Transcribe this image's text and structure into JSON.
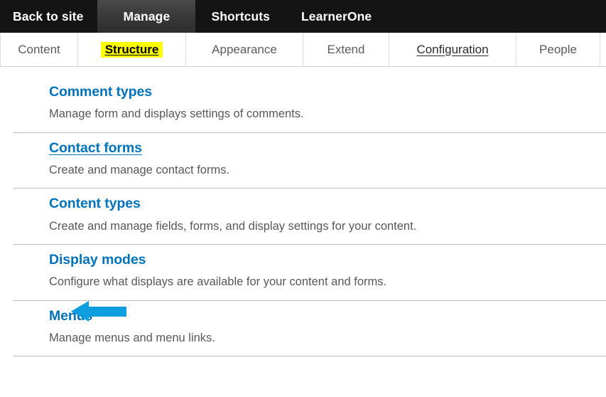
{
  "toolbar": {
    "tabs": [
      {
        "label": "Back to site",
        "active": false,
        "name": "back-to-site"
      },
      {
        "label": "Manage",
        "active": true,
        "name": "manage"
      },
      {
        "label": "Shortcuts",
        "active": false,
        "name": "shortcuts"
      },
      {
        "label": "LearnerOne",
        "active": false,
        "name": "learnerone"
      }
    ]
  },
  "subnav": {
    "tabs": [
      {
        "label": "Content",
        "state": "default"
      },
      {
        "label": "Structure",
        "state": "highlighted"
      },
      {
        "label": "Appearance",
        "state": "default"
      },
      {
        "label": "Extend",
        "state": "default"
      },
      {
        "label": "Configuration",
        "state": "hovered"
      },
      {
        "label": "People",
        "state": "default"
      }
    ]
  },
  "main": {
    "items": [
      {
        "title": "Comment types",
        "description": "Manage form and displays settings of comments.",
        "underlined": false,
        "annotated": false
      },
      {
        "title": "Contact forms",
        "description": "Create and manage contact forms.",
        "underlined": true,
        "annotated": false
      },
      {
        "title": "Content types",
        "description": "Create and manage fields, forms, and display settings for your content.",
        "underlined": false,
        "annotated": false
      },
      {
        "title": "Display modes",
        "description": "Configure what displays are available for your content and forms.",
        "underlined": false,
        "annotated": false
      },
      {
        "title": "Menus",
        "description": "Manage menus and menu links.",
        "underlined": false,
        "annotated": true
      }
    ]
  },
  "annotation": {
    "arrow_color": "#0d9ee0",
    "arrow_direction": "left",
    "points_at": "Menus"
  },
  "colors": {
    "toolbar_bg": "#141414",
    "toolbar_active_bg": "#3a3a3a",
    "link_blue": "#0072b9",
    "highlight_yellow": "#ffff00",
    "body_text": "#58585a",
    "divider": "#bdbdbd"
  }
}
